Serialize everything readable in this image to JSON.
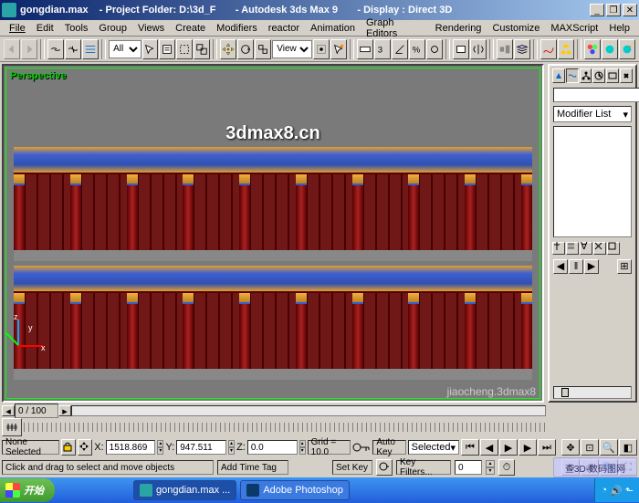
{
  "title": "gongdian.max    - Project Folder: D:\\3d_F       - Autodesk 3ds Max 9       - Display : Direct 3D",
  "menu": [
    "File",
    "Edit",
    "Tools",
    "Group",
    "Views",
    "Create",
    "Modifiers",
    "reactor",
    "Animation",
    "Graph Editors",
    "Rendering",
    "Customize",
    "MAXScript",
    "Help"
  ],
  "toolbar": {
    "selset": "All",
    "viewmode": "View"
  },
  "viewport": {
    "label": "Perspective",
    "watermark": "3dmax8.cn",
    "watermark2": "jiaocheng.3dmax8"
  },
  "axis": {
    "x": "x",
    "y": "y",
    "z": "z"
  },
  "rightpanel": {
    "modlist": "Modifier List"
  },
  "scroll": {
    "framelabel": "0 / 100"
  },
  "status": {
    "sel": "None Selected",
    "x_label": "X:",
    "x": "1518.869",
    "y_label": "Y:",
    "y": "947.511",
    "z_label": "Z:",
    "z": "0.0",
    "grid": "Grid = 10.0",
    "autokey": "Auto Key",
    "selected": "Selected",
    "prompt": "Click and drag to select and move objects",
    "addtimetag": "Add Time Tag",
    "setkey": "Set Key",
    "keyfilters": "Key Filters..."
  },
  "taskbar": {
    "start": "开始",
    "tasks": [
      "gongdian.max ...",
      "Adobe Photoshop"
    ]
  },
  "playframe": "0"
}
